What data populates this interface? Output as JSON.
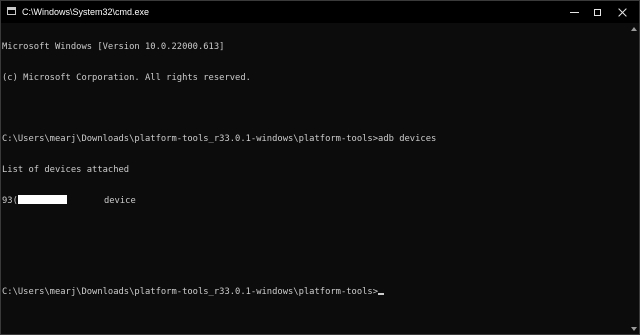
{
  "window": {
    "title": "C:\\Windows\\System32\\cmd.exe",
    "icon": "command-prompt-icon"
  },
  "controls": {
    "minimize_icon": "minimize-icon",
    "maximize_icon": "maximize-icon",
    "close_icon": "close-icon"
  },
  "console": {
    "lines": [
      "Microsoft Windows [Version 10.0.22000.613]",
      "(c) Microsoft Corporation. All rights reserved.",
      "",
      "C:\\Users\\mearj\\Downloads\\platform-tools_r33.0.1-windows\\platform-tools>adb devices",
      "List of devices attached"
    ],
    "device_prefix": "93(",
    "device_state": "device",
    "prompt": "C:\\Users\\mearj\\Downloads\\platform-tools_r33.0.1-windows\\platform-tools>"
  },
  "colors": {
    "background": "#0c0c0c",
    "text": "#cccccc",
    "titlebar": "#000000"
  }
}
